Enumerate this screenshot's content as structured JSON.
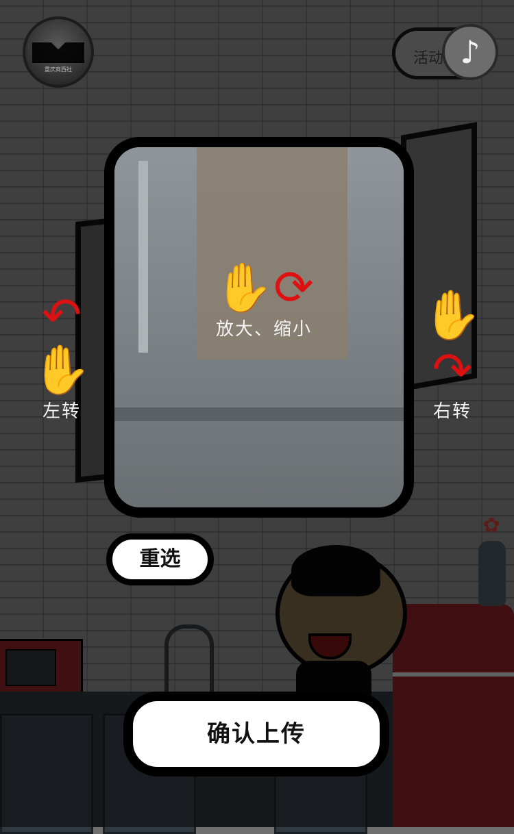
{
  "header": {
    "logo_text": "重庆商西社",
    "activity_label": "活动",
    "music_icon": "music-note-icon"
  },
  "editor": {
    "left_rotate_label": "左转",
    "right_rotate_label": "右转",
    "zoom_label": "放大、缩小"
  },
  "actions": {
    "reselect_label": "重选",
    "confirm_label": "确认上传"
  }
}
